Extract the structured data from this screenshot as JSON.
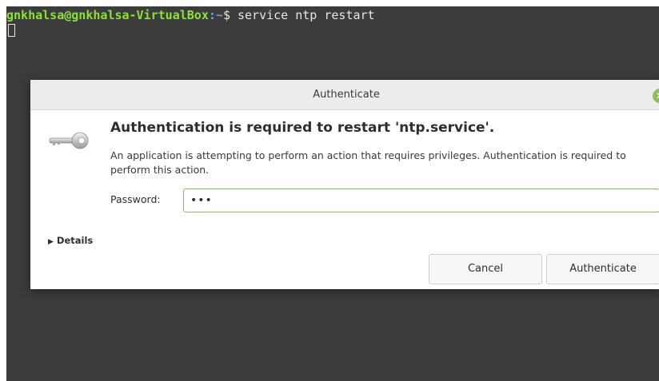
{
  "terminal": {
    "user_host": "gnkhalsa@gnkhalsa-VirtualBox",
    "path": ":~",
    "prompt_symbol": "$",
    "command": " service ntp restart"
  },
  "dialog": {
    "title": "Authenticate",
    "heading": "Authentication is required to restart 'ntp.service'.",
    "message": "An application is attempting to perform an action that requires privileges. Authentication is required to perform this action.",
    "password_label": "Password:",
    "password_value": "•••",
    "details_label": "Details",
    "cancel_label": "Cancel",
    "authenticate_label": "Authenticate",
    "icons": {
      "close": "close-icon",
      "key": "key-icon",
      "expander": "triangle-right-icon"
    }
  },
  "colors": {
    "terminal_bg": "#3c3c3c",
    "user_green": "#8ae234",
    "path_blue": "#729fcf",
    "accent_green": "#8fbf5a"
  }
}
